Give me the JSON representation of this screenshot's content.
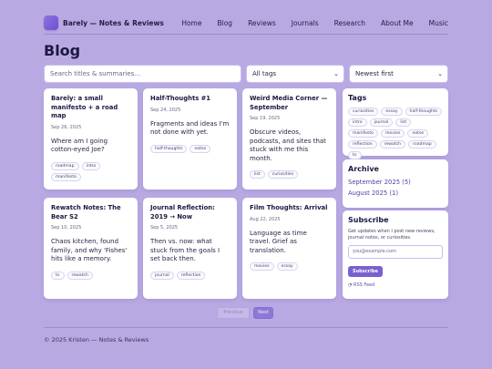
{
  "header": {
    "brand": "Barely — Notes & Reviews",
    "logo_icon": "logo-square-icon",
    "nav": [
      "Home",
      "Blog",
      "Reviews",
      "Journals",
      "Research",
      "About Me",
      "Music"
    ]
  },
  "page_title": "Blog",
  "controls": {
    "search_placeholder": "Search titles & summaries…",
    "tags_select": "All tags",
    "sort_select": "Newest first",
    "chevron_icon": "chevron-down-icon"
  },
  "posts": [
    {
      "title": "Barely: a small manifesto + a road map",
      "date": "Sep 26, 2025",
      "summary": "Where am I going cotton-eyed Joe?",
      "tags": [
        "roadmap",
        "intro",
        "manifesto"
      ]
    },
    {
      "title": "Half-Thoughts #1",
      "date": "Sep 24, 2025",
      "summary": "Fragments and ideas I'm not done with yet.",
      "tags": [
        "half-thoughts",
        "notes"
      ]
    },
    {
      "title": "Weird Media Corner — September",
      "date": "Sep 19, 2025",
      "summary": "Obscure videos, podcasts, and sites that stuck with me this month.",
      "tags": [
        "list",
        "curiosities"
      ]
    },
    {
      "title": "Rewatch Notes: The Bear S2",
      "date": "Sep 10, 2025",
      "summary": "Chaos kitchen, found family, and why 'Fishes' hits like a memory.",
      "tags": [
        "tv",
        "rewatch"
      ]
    },
    {
      "title": "Journal Reflection: 2019 → Now",
      "date": "Sep 5, 2025",
      "summary": "Then vs. now: what stuck from the goals I set back then.",
      "tags": [
        "journal",
        "reflection"
      ]
    },
    {
      "title": "Film Thoughts: Arrival",
      "date": "Aug 22, 2025",
      "summary": "Language as time travel. Grief as translation.",
      "tags": [
        "movies",
        "essay"
      ]
    }
  ],
  "sidebar": {
    "tags_title": "Tags",
    "tags": [
      "curiosities",
      "essay",
      "half-thoughts",
      "intro",
      "journal",
      "list",
      "manifesto",
      "movies",
      "notes",
      "reflection",
      "rewatch",
      "roadmap",
      "tv"
    ],
    "archive_title": "Archive",
    "archive": [
      "September 2025 (5)",
      "August 2025 (1)"
    ],
    "subscribe_title": "Subscribe",
    "subscribe_text": "Get updates when I post new reviews, journal notes, or curiosities.",
    "email_placeholder": "you@example.com",
    "subscribe_button": "Subscribe",
    "rss_link": "RSS Feed",
    "rss_icon": "rss-icon"
  },
  "pagination": {
    "prev": "Previous",
    "next": "Next"
  },
  "footer": "© 2025 Kristen — Notes & Reviews"
}
